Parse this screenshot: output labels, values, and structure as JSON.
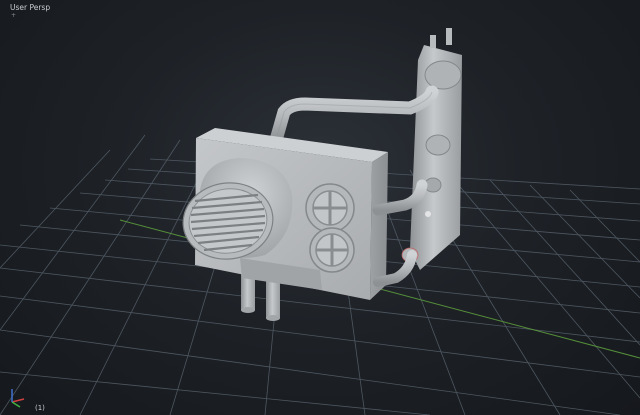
{
  "viewport": {
    "label": "User Persp",
    "sub_indicator": "+",
    "frame_number": "(1)",
    "colors": {
      "background": "#1e2227",
      "grid": "#5a6470",
      "x_axis": "#5c9c3c",
      "model": "#b9bcbf",
      "model_shadow": "#8a8d90"
    }
  },
  "gizmo": {
    "icon": "axis-gizmo-icon",
    "axes": [
      "x",
      "y",
      "z"
    ]
  }
}
